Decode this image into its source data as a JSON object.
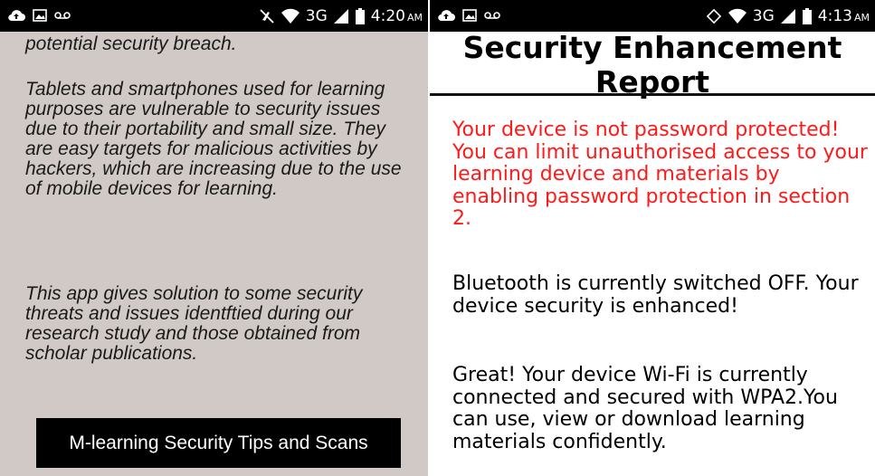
{
  "left_screen": {
    "status_bar": {
      "signal_label": "3G",
      "time": "4:20",
      "am_pm": "AM",
      "icons": [
        "cloud-upload-icon",
        "image-icon",
        "voicemail-icon",
        "mute-icon",
        "wifi-icon",
        "signal-icon",
        "battery-icon"
      ]
    },
    "paragraphs": {
      "p1": "potential security breach.",
      "p2": "Tablets and smartphones used for learning purposes are vulnerable to security issues due to their portability and small size. They are easy targets for malicious activities by hackers, which are increasing due to the use of mobile devices for learning.",
      "p3": "This app gives solution to some security threats and issues identftied during our research study and those obtained from scholar publications."
    },
    "tips_button_label": "M-learning Security Tips and Scans",
    "colors": {
      "background": "#d1c9c5",
      "button": "#000000"
    }
  },
  "right_screen": {
    "status_bar": {
      "signal_label": "3G",
      "time": "4:13",
      "am_pm": "AM",
      "icons": [
        "cloud-upload-icon",
        "image-icon",
        "voicemail-icon",
        "rotate-icon",
        "wifi-icon",
        "signal-icon",
        "battery-icon"
      ]
    },
    "title": "Security Enhancement Report",
    "messages": {
      "password": "Your device is not password protected! You can limit unauthorised access to your learning device and materials by enabling password protection in section 2.",
      "bluetooth": "Bluetooth is currently switched OFF. Your device security is enhanced!",
      "wifi": "Great! Your device Wi-Fi is currently connected and secured with WPA2.You can use, view or download learning materials confidently."
    },
    "colors": {
      "warning": "#ff1a1a",
      "text": "#000000"
    }
  }
}
